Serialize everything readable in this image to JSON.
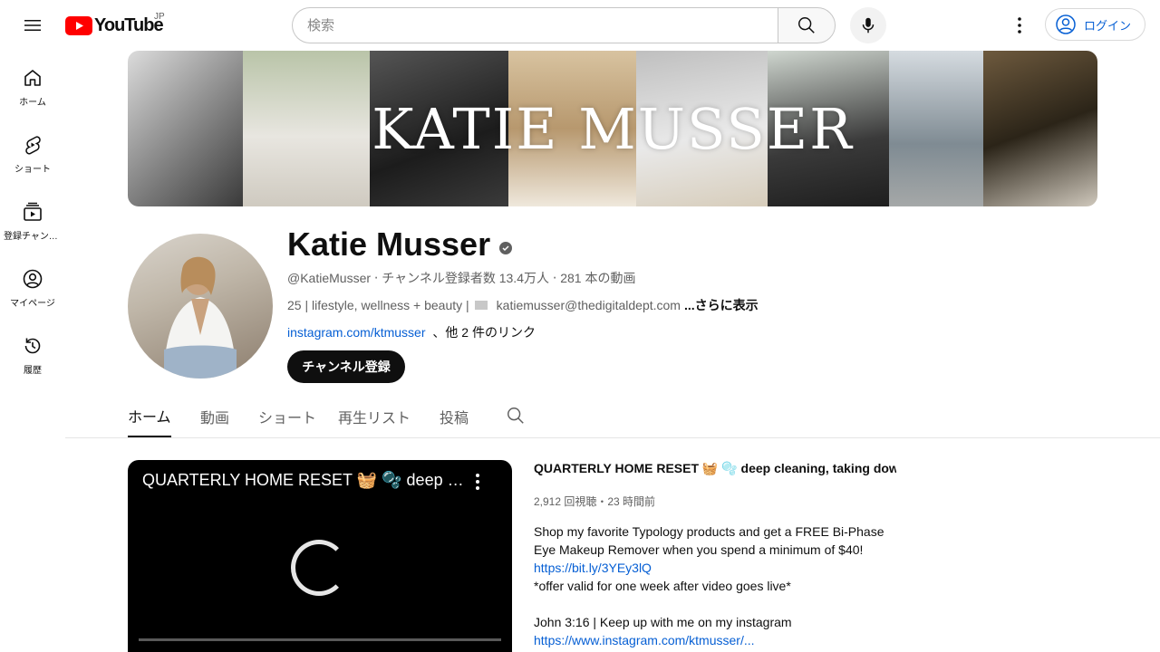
{
  "header": {
    "logo_text": "YouTube",
    "region": "JP",
    "search_placeholder": "検索",
    "login_label": "ログイン"
  },
  "sidebar": {
    "items": [
      {
        "label": "ホーム",
        "icon": "home-icon"
      },
      {
        "label": "ショート",
        "icon": "shorts-icon"
      },
      {
        "label": "登録チャンネル",
        "icon": "subscriptions-icon"
      },
      {
        "label": "マイページ",
        "icon": "profile-icon"
      },
      {
        "label": "履歴",
        "icon": "history-icon"
      }
    ]
  },
  "banner": {
    "title": "KATIE MUSSER"
  },
  "channel": {
    "name": "Katie Musser",
    "handle": "@KatieMusser",
    "subscribers": "チャンネル登録者数 13.4万人",
    "video_count": "281 本の動画",
    "description": "25 | lifestyle, wellness + beauty |",
    "email": "katiemusser@thedigitaldept.com",
    "more_label": "...さらに表示",
    "link": "instagram.com/ktmusser",
    "other_links": "、他 2 件のリンク",
    "subscribe_label": "チャンネル登録"
  },
  "tabs": [
    {
      "label": "ホーム",
      "active": true
    },
    {
      "label": "動画",
      "active": false
    },
    {
      "label": "ショート",
      "active": false
    },
    {
      "label": "再生リスト",
      "active": false
    },
    {
      "label": "投稿",
      "active": false
    }
  ],
  "featured_video": {
    "player_title": "QUARTERLY HOME RESET 🧺 🫧 deep cleaning, taking down fall decor",
    "title": "QUARTERLY HOME RESET 🧺 🫧 deep cleaning, taking down f...",
    "stats": "2,912 回視聴・23 時間前",
    "description_lines": [
      "Shop my favorite Typology products and get a FREE Bi-Phase",
      "Eye Makeup Remover when you spend a minimum of $40!",
      "https://bit.ly/3YEy3lQ",
      "*offer valid for one week after video goes live*",
      "",
      "John 3:16 | Keep up with me on my instagram",
      "https://www.instagram.com/ktmusser/..."
    ]
  },
  "colors": {
    "brand_red": "#ff0000",
    "link_blue": "#065fd4",
    "text": "#0f0f0f",
    "secondary_text": "#606060"
  }
}
